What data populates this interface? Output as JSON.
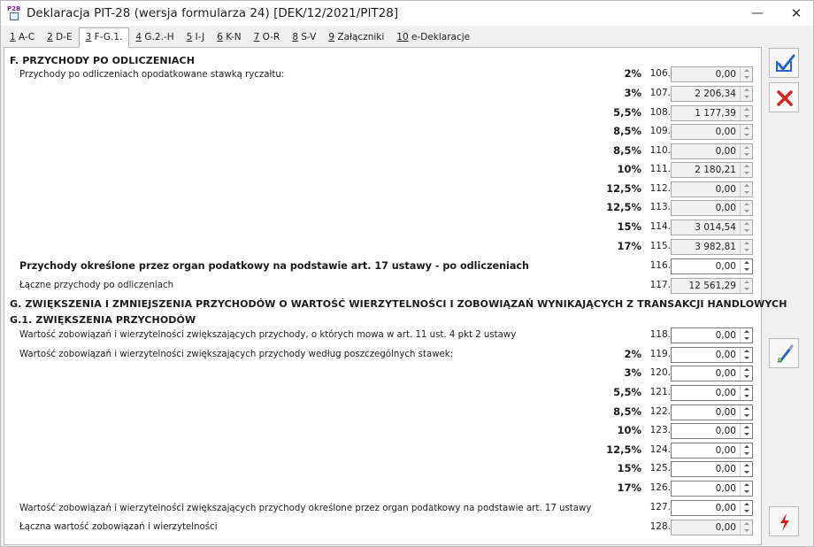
{
  "window": {
    "title": "Deklaracja PIT-28 (wersja formularza 24) [DEK/12/2021/PIT28]",
    "app_icon_text": "P2B"
  },
  "tabs": [
    {
      "key": "1",
      "label": " A-C"
    },
    {
      "key": "2",
      "label": " D-E"
    },
    {
      "key": "3",
      "label": " F-G.1."
    },
    {
      "key": "4",
      "label": " G.2.-H"
    },
    {
      "key": "5",
      "label": " I-J"
    },
    {
      "key": "6",
      "label": " K-N"
    },
    {
      "key": "7",
      "label": " O-R"
    },
    {
      "key": "8",
      "label": " S-V"
    },
    {
      "key": "9",
      "label": " Załączniki"
    },
    {
      "key": "10",
      "label": " e-Deklaracje"
    }
  ],
  "section_f": {
    "header": "F. PRZYCHODY PO ODLICZENIACH",
    "label": "Przychody po odliczeniach opodatkowane stawką ryczałtu:",
    "rows": [
      {
        "rate": "2%",
        "num": "106.",
        "value": "0,00"
      },
      {
        "rate": "3%",
        "num": "107.",
        "value": "2 206,34"
      },
      {
        "rate": "5,5%",
        "num": "108.",
        "value": "1 177,39"
      },
      {
        "rate": "8,5%",
        "num": "109.",
        "value": "0,00"
      },
      {
        "rate": "8,5%",
        "num": "110.",
        "value": "0,00"
      },
      {
        "rate": "10%",
        "num": "111.",
        "value": "2 180,21"
      },
      {
        "rate": "12,5%",
        "num": "112.",
        "value": "0,00"
      },
      {
        "rate": "12,5%",
        "num": "113.",
        "value": "0,00"
      },
      {
        "rate": "15%",
        "num": "114.",
        "value": "3 014,54"
      },
      {
        "rate": "17%",
        "num": "115.",
        "value": "3 982,81"
      }
    ],
    "art17_label": "Przychody określone przez organ podatkowy na podstawie art. 17 ustawy - po odliczeniach",
    "art17_num": "116.",
    "art17_value": "0,00",
    "total_label": "Łączne przychody po odliczeniach",
    "total_num": "117.",
    "total_value": "12 561,29"
  },
  "section_g": {
    "header": "G. ZWIĘKSZENIA I ZMNIEJSZENIA PRZYCHODÓW O WARTOŚĆ WIERZYTELNOŚCI I ZOBOWIĄZAŃ WYNIKAJĄCYCH Z TRANSAKCJI HANDLOWYCH",
    "sub_header": "G.1. ZWIĘKSZENIA PRZYCHODÓW",
    "art11_label": "Wartość zobowiązań i wierzytelności zwiększających przychody, o których mowa w art. 11 ust. 4 pkt 2 ustawy",
    "art11_num": "118.",
    "art11_value": "0,00",
    "rates_label": "Wartość zobowiązań i wierzytelności zwiększających przychody według poszczególnych stawek:",
    "rows": [
      {
        "rate": "2%",
        "num": "119.",
        "value": "0,00"
      },
      {
        "rate": "3%",
        "num": "120.",
        "value": "0,00"
      },
      {
        "rate": "5,5%",
        "num": "121.",
        "value": "0,00"
      },
      {
        "rate": "8,5%",
        "num": "122.",
        "value": "0,00"
      },
      {
        "rate": "10%",
        "num": "123.",
        "value": "0,00"
      },
      {
        "rate": "12,5%",
        "num": "124.",
        "value": "0,00"
      },
      {
        "rate": "15%",
        "num": "125.",
        "value": "0,00"
      },
      {
        "rate": "17%",
        "num": "126.",
        "value": "0,00"
      }
    ],
    "art17_label": "Wartość zobowiązań i wierzytelności zwiększających przychody określone przez organ podatkowy na podstawie art. 17 ustawy",
    "art17_num": "127.",
    "art17_value": "0,00",
    "total_label": "Łączna wartość zobowiązań i wierzytelności",
    "total_num": "128.",
    "total_value": "0,00"
  },
  "colors": {
    "accent_blue": "#2a66c9",
    "cancel_red": "#d9261c",
    "bolt_red": "#d11f1f"
  }
}
